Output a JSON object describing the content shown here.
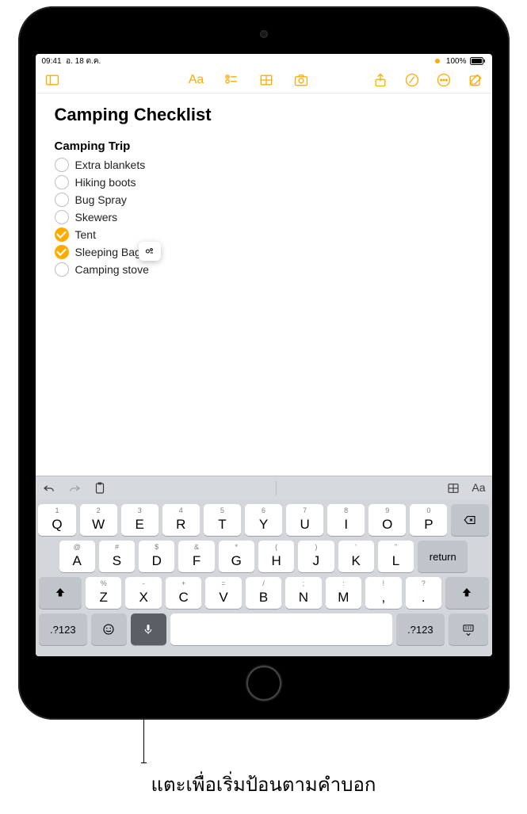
{
  "status": {
    "time": "09:41",
    "date": "อ. 18 ต.ค.",
    "battery_pct": "100%"
  },
  "toolbar": {
    "sidebar": "sidebar",
    "format": "Aa",
    "checklist": "checklist",
    "table": "table",
    "camera": "camera",
    "share": "share",
    "markup": "markup",
    "more": "more",
    "compose": "compose"
  },
  "note": {
    "title": "Camping Checklist",
    "subtitle": "Camping Trip",
    "items": [
      {
        "text": "Extra blankets",
        "checked": false
      },
      {
        "text": "Hiking boots",
        "checked": false
      },
      {
        "text": "Bug Spray",
        "checked": false
      },
      {
        "text": "Skewers",
        "checked": false
      },
      {
        "text": "Tent",
        "checked": true
      },
      {
        "text": "Sleeping Bag",
        "checked": true
      },
      {
        "text": "Camping stove",
        "checked": false
      }
    ]
  },
  "kbd_bar": {
    "table_label": "table",
    "aa_label": "Aa"
  },
  "keyboard": {
    "row1": [
      {
        "main": "Q",
        "sup": "1"
      },
      {
        "main": "W",
        "sup": "2"
      },
      {
        "main": "E",
        "sup": "3"
      },
      {
        "main": "R",
        "sup": "4"
      },
      {
        "main": "T",
        "sup": "5"
      },
      {
        "main": "Y",
        "sup": "6"
      },
      {
        "main": "U",
        "sup": "7"
      },
      {
        "main": "I",
        "sup": "8"
      },
      {
        "main": "O",
        "sup": "9"
      },
      {
        "main": "P",
        "sup": "0"
      }
    ],
    "row2": [
      {
        "main": "A",
        "sup": "@"
      },
      {
        "main": "S",
        "sup": "#"
      },
      {
        "main": "D",
        "sup": "$"
      },
      {
        "main": "F",
        "sup": "&"
      },
      {
        "main": "G",
        "sup": "*"
      },
      {
        "main": "H",
        "sup": "("
      },
      {
        "main": "J",
        "sup": ")"
      },
      {
        "main": "K",
        "sup": "'"
      },
      {
        "main": "L",
        "sup": "\""
      }
    ],
    "row3": [
      {
        "main": "Z",
        "sup": "%"
      },
      {
        "main": "X",
        "sup": "-"
      },
      {
        "main": "C",
        "sup": "+"
      },
      {
        "main": "V",
        "sup": "="
      },
      {
        "main": "B",
        "sup": "/"
      },
      {
        "main": "N",
        "sup": ";"
      },
      {
        "main": "M",
        "sup": ":"
      }
    ],
    "punct": {
      "comma_sup": "!",
      "comma": ",",
      "period_sup": "?",
      "period": "."
    },
    "return": "return",
    "numkey": ".?123"
  },
  "callout": "แตะเพื่อเริ่มป้อนตามคำบอก"
}
